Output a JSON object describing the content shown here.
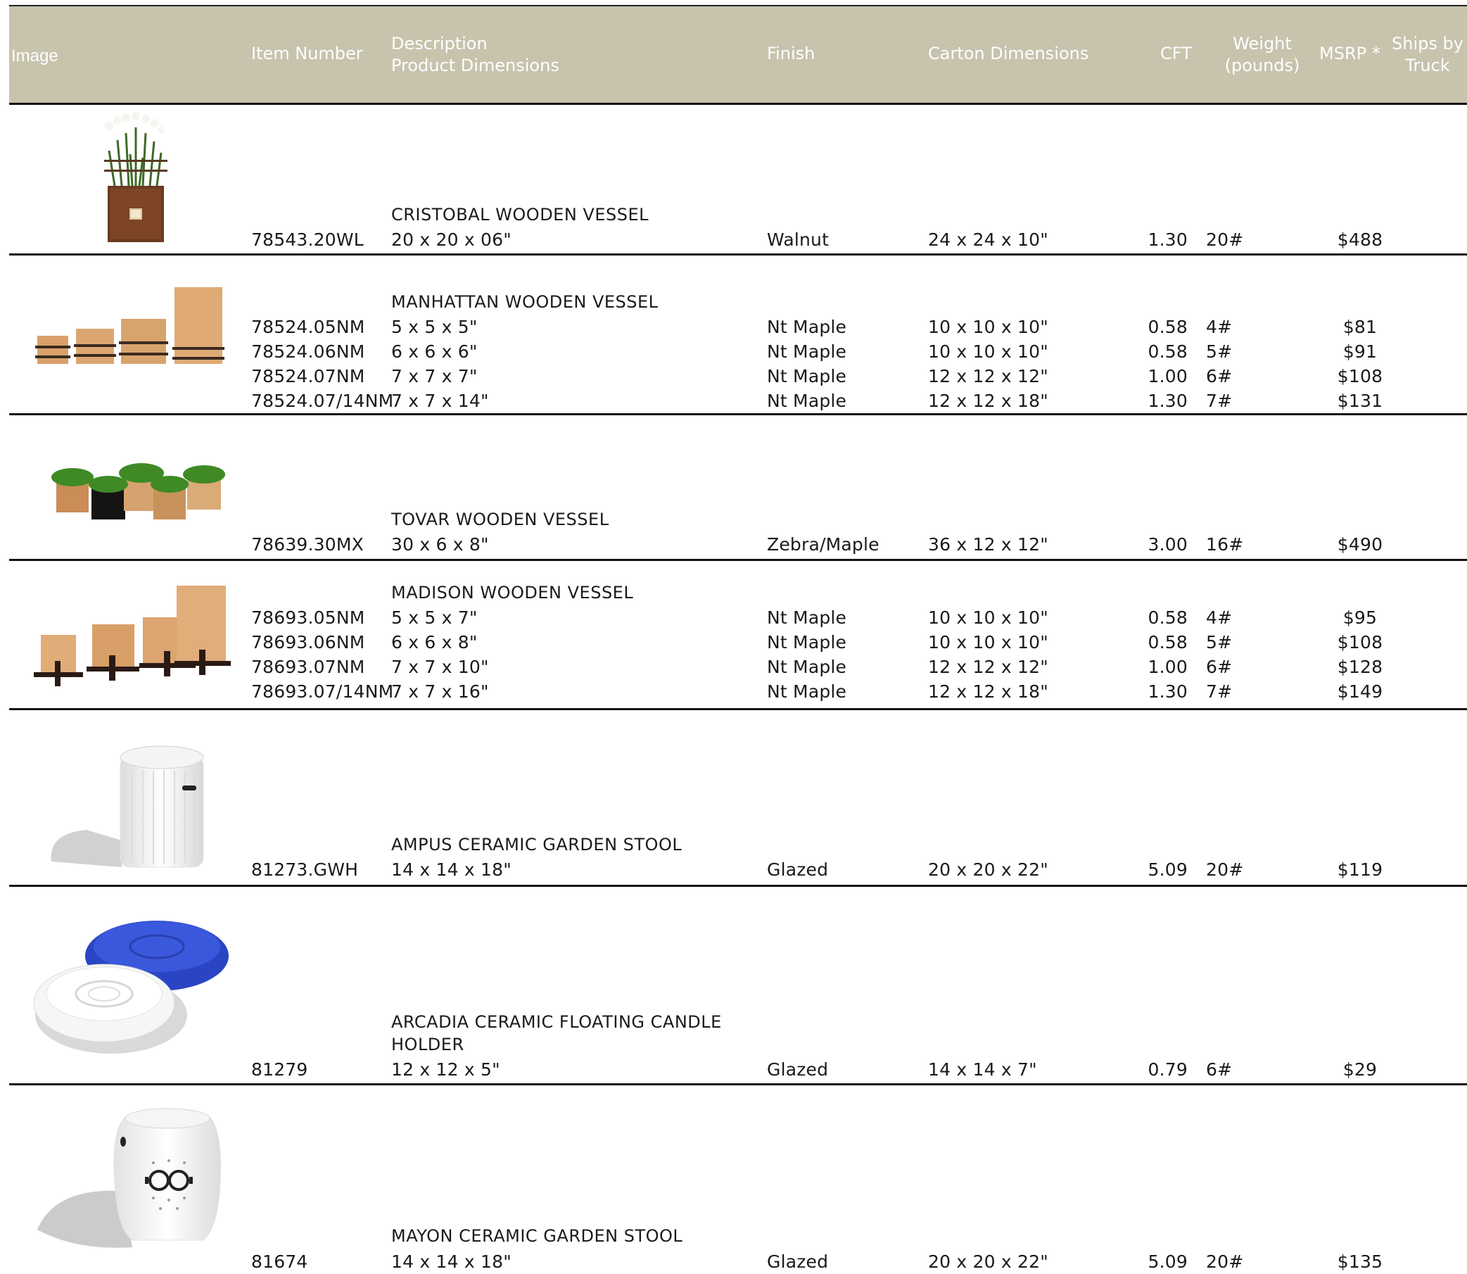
{
  "header": {
    "image": "Image",
    "item_number": "Item Number",
    "description": "Description",
    "product_dimensions": "Product Dimensions",
    "finish": "Finish",
    "carton_dimensions": "Carton Dimensions",
    "cft": "CFT",
    "weight_line1": "Weight",
    "weight_line2": "(pounds)",
    "msrp": "MSRP *",
    "ships_line1": "Ships by",
    "ships_line2": "Truck"
  },
  "products": [
    {
      "name": "CRISTOBAL WOODEN VESSEL",
      "image": "wooden-planter-with-flowers-icon",
      "items": [
        {
          "item": "78543.20WL",
          "dims": "20 x 20 x 06\"",
          "finish": "Walnut",
          "carton": "24 x 24 x 10\"",
          "cft": "1.30",
          "weight": "20#",
          "msrp": "$488"
        }
      ]
    },
    {
      "name": "MANHATTAN WOODEN VESSEL",
      "image": "wooden-boxes-icon",
      "items": [
        {
          "item": "78524.05NM",
          "dims": "5 x 5 x 5\"",
          "finish": "Nt Maple",
          "carton": "10 x 10 x 10\"",
          "cft": "0.58",
          "weight": "4#",
          "msrp": "$81"
        },
        {
          "item": "78524.06NM",
          "dims": "6 x 6 x 6\"",
          "finish": "Nt Maple",
          "carton": "10 x 10 x 10\"",
          "cft": "0.58",
          "weight": "5#",
          "msrp": "$91"
        },
        {
          "item": "78524.07NM",
          "dims": "7 x 7 x 7\"",
          "finish": "Nt Maple",
          "carton": "12 x 12 x 12\"",
          "cft": "1.00",
          "weight": "6#",
          "msrp": "$108"
        },
        {
          "item": "78524.07/14NM",
          "dims": "7 x 7 x 14\"",
          "finish": "Nt Maple",
          "carton": "12 x 12 x 18\"",
          "cft": "1.30",
          "weight": "7#",
          "msrp": "$131"
        }
      ]
    },
    {
      "name": "TOVAR WOODEN VESSEL",
      "image": "grass-planters-icon",
      "items": [
        {
          "item": "78639.30MX",
          "dims": "30 x 6 x 8\"",
          "finish": "Zebra/Maple",
          "carton": "36 x 12 x 12\"",
          "cft": "3.00",
          "weight": "16#",
          "msrp": "$490"
        }
      ]
    },
    {
      "name": "MADISON WOODEN VESSEL",
      "image": "wooden-boxes-on-stands-icon",
      "items": [
        {
          "item": "78693.05NM",
          "dims": "5 x 5 x 7\"",
          "finish": "Nt Maple",
          "carton": "10 x 10 x 10\"",
          "cft": "0.58",
          "weight": "4#",
          "msrp": "$95"
        },
        {
          "item": "78693.06NM",
          "dims": "6 x 6 x 8\"",
          "finish": "Nt Maple",
          "carton": "10 x 10 x 10\"",
          "cft": "0.58",
          "weight": "5#",
          "msrp": "$108"
        },
        {
          "item": "78693.07NM",
          "dims": "7 x 7 x 10\"",
          "finish": "Nt Maple",
          "carton": "12 x 12 x 12\"",
          "cft": "1.00",
          "weight": "6#",
          "msrp": "$128"
        },
        {
          "item": "78693.07/14NM",
          "dims": "7 x 7 x 16\"",
          "finish": "Nt Maple",
          "carton": "12 x 12 x 18\"",
          "cft": "1.30",
          "weight": "7#",
          "msrp": "$149"
        }
      ]
    },
    {
      "name": "AMPUS CERAMIC GARDEN STOOL",
      "image": "ceramic-stool-icon",
      "items": [
        {
          "item": "81273.GWH",
          "dims": "14 x 14 x 18\"",
          "finish": "Glazed",
          "carton": "20 x 20 x 22\"",
          "cft": "5.09",
          "weight": "20#",
          "msrp": "$119"
        }
      ]
    },
    {
      "name": "ARCADIA CERAMIC FLOATING CANDLE",
      "name_line2": "HOLDER",
      "image": "floating-candle-holders-icon",
      "items": [
        {
          "item": "81279",
          "dims": "12 x 12 x 5\"",
          "finish": "Glazed",
          "carton": "14 x 14 x 7\"",
          "cft": "0.79",
          "weight": "6#",
          "msrp": "$29"
        }
      ]
    },
    {
      "name": "MAYON CERAMIC GARDEN STOOL",
      "image": "ceramic-drum-stool-icon",
      "items": [
        {
          "item": "81674",
          "dims": "14 x 14 x 18\"",
          "finish": "Glazed",
          "carton": "20 x 20 x 22\"",
          "cft": "5.09",
          "weight": "20#",
          "msrp": "$135"
        }
      ]
    }
  ]
}
